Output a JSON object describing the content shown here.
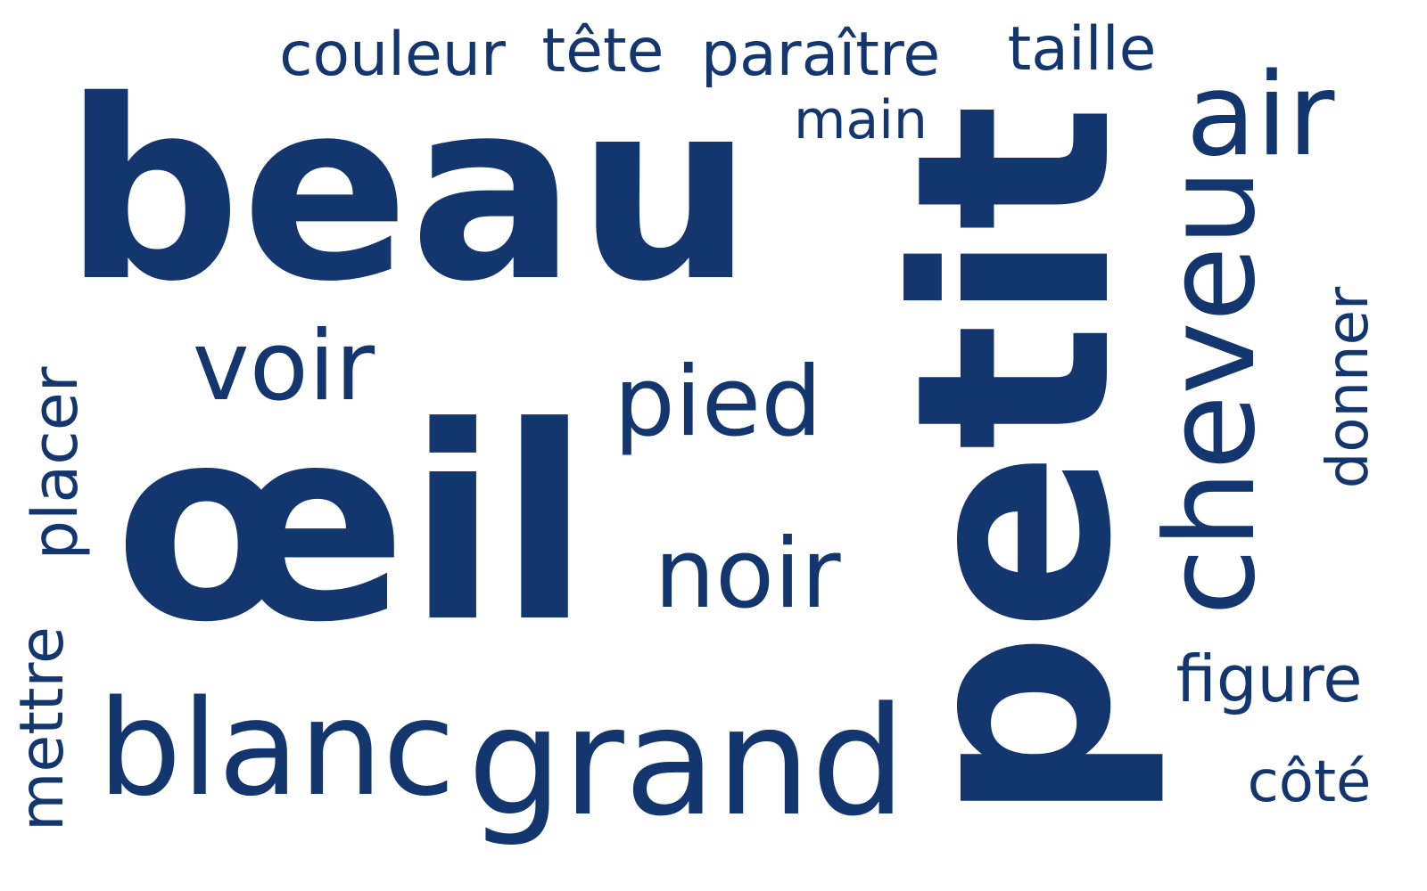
{
  "wordcloud": {
    "color": "#14366f",
    "background": "#ffffff",
    "words": {
      "beau": "beau",
      "oeil": "œil",
      "petit": "petit",
      "grand": "grand",
      "blanc": "blanc",
      "voir": "voir",
      "pied": "pied",
      "noir": "noir",
      "cheveu": "cheveu",
      "air": "air",
      "couleur": "couleur",
      "tete": "tête",
      "paraitre": "paraître",
      "taille": "taille",
      "main": "main",
      "figure": "figure",
      "cote": "côté",
      "donner": "donner",
      "placer": "placer",
      "mettre": "mettre"
    }
  }
}
